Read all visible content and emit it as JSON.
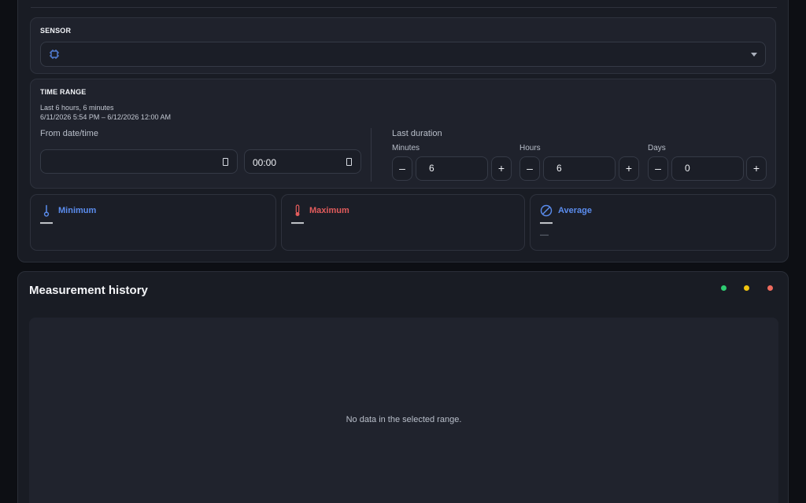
{
  "sensor": {
    "title": "SENSOR",
    "selected_value": "",
    "icon": "chip-icon"
  },
  "time_range": {
    "title": "TIME RANGE",
    "summary": "Last 6 hours, 6 minutes",
    "range_text": "6/11/2026 5:54 PM – 6/12/2026 12:00 AM",
    "from_label": "From date/time",
    "date_value": "",
    "time_value": "00:00",
    "duration_label": "Last duration",
    "minutes_label": "Minutes",
    "minutes_value": "6",
    "hours_label": "Hours",
    "hours_value": "6",
    "days_label": "Days",
    "days_value": "0",
    "decrement": "–",
    "increment": "+"
  },
  "stats": {
    "minimum": {
      "label": "Minimum",
      "value": "—",
      "color": "#5b8def"
    },
    "maximum": {
      "label": "Maximum",
      "value": "—",
      "color": "#e25c5c"
    },
    "average": {
      "label": "Average",
      "value": "—",
      "sub": "—",
      "color": "#5b8def"
    }
  },
  "history": {
    "title": "Measurement history",
    "empty_message": "No data in the selected range.",
    "dot_colors": [
      "#2ecc71",
      "#f1c40f",
      "#ef6b5e"
    ]
  }
}
